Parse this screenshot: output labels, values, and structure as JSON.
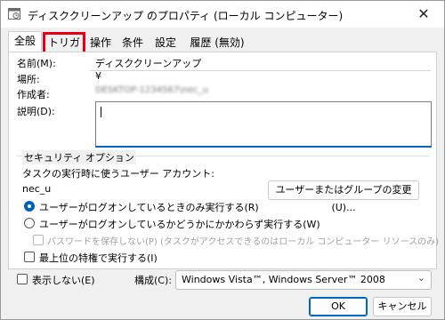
{
  "window": {
    "title": "ディスククリーンアップ のプロパティ (ローカル コンピューター)",
    "close_glyph": "✕"
  },
  "tabs": [
    {
      "label": "全般",
      "active": true
    },
    {
      "label": "トリガー",
      "highlighted": true,
      "highlight_color": "#e60012"
    },
    {
      "label": "操作"
    },
    {
      "label": "条件"
    },
    {
      "label": "設定"
    },
    {
      "label": "履歴 (無効)"
    }
  ],
  "general": {
    "name_label": "名前(M):",
    "name_value": "ディスククリーンアップ",
    "location_label": "場所:",
    "location_value": "¥",
    "author_label": "作成者:",
    "author_value": "DESKTOP-1234567\\nec_u",
    "description_label": "説明(D):",
    "description_value": ""
  },
  "security": {
    "group_label": "セキュリティ オプション",
    "account_prompt": "タスクの実行時に使うユーザー アカウント:",
    "account_value": "nec_u",
    "change_button": "ユーザーまたはグループの変更(U)...",
    "radio_logged_on": "ユーザーがログオンしているときのみ実行する(R)",
    "radio_always": "ユーザーがログオンしているかどうかにかかわらず実行する(W)",
    "no_store_password": "パスワードを保存しない(P) (タスクがアクセスできるのはローカル コンピューター リソースのみ)",
    "highest_privileges": "最上位の特権で実行する(I)",
    "selected_radio": "logged_on"
  },
  "bottom": {
    "hidden_label": "表示しない(E)",
    "configure_label": "構成(C):",
    "configure_value": "Windows Vista™, Windows Server™ 2008",
    "ok_button": "OK",
    "cancel_button": "キャンセル"
  },
  "colors": {
    "accent": "#005fb8",
    "highlight": "#e60012"
  }
}
